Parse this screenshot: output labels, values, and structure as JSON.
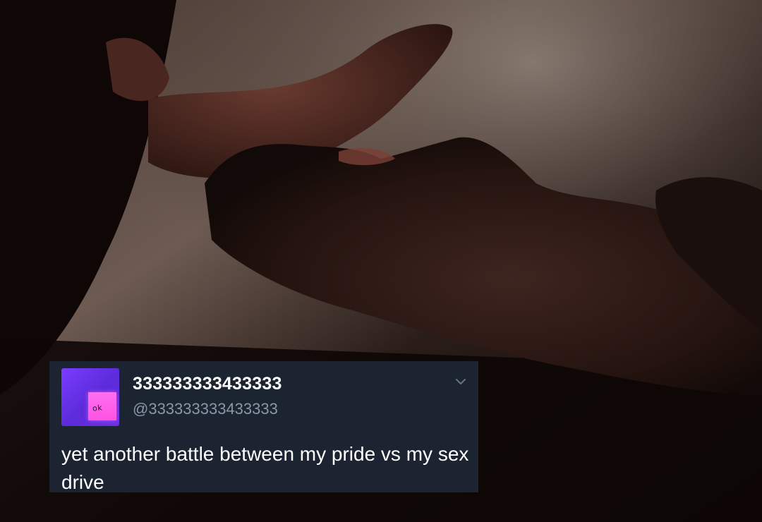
{
  "tweet": {
    "display_name": "333333333433333",
    "handle": "@333333333433333",
    "avatar_label": "ok",
    "text": "yet another battle between my pride vs my sex drive",
    "menu_icon": "chevron-down-icon"
  },
  "colors": {
    "card_background": "#1b2430",
    "name_text": "#ffffff",
    "handle_text": "#8899a6",
    "avatar_purple": "#7b3cff",
    "avatar_pink": "#ff52e3"
  }
}
